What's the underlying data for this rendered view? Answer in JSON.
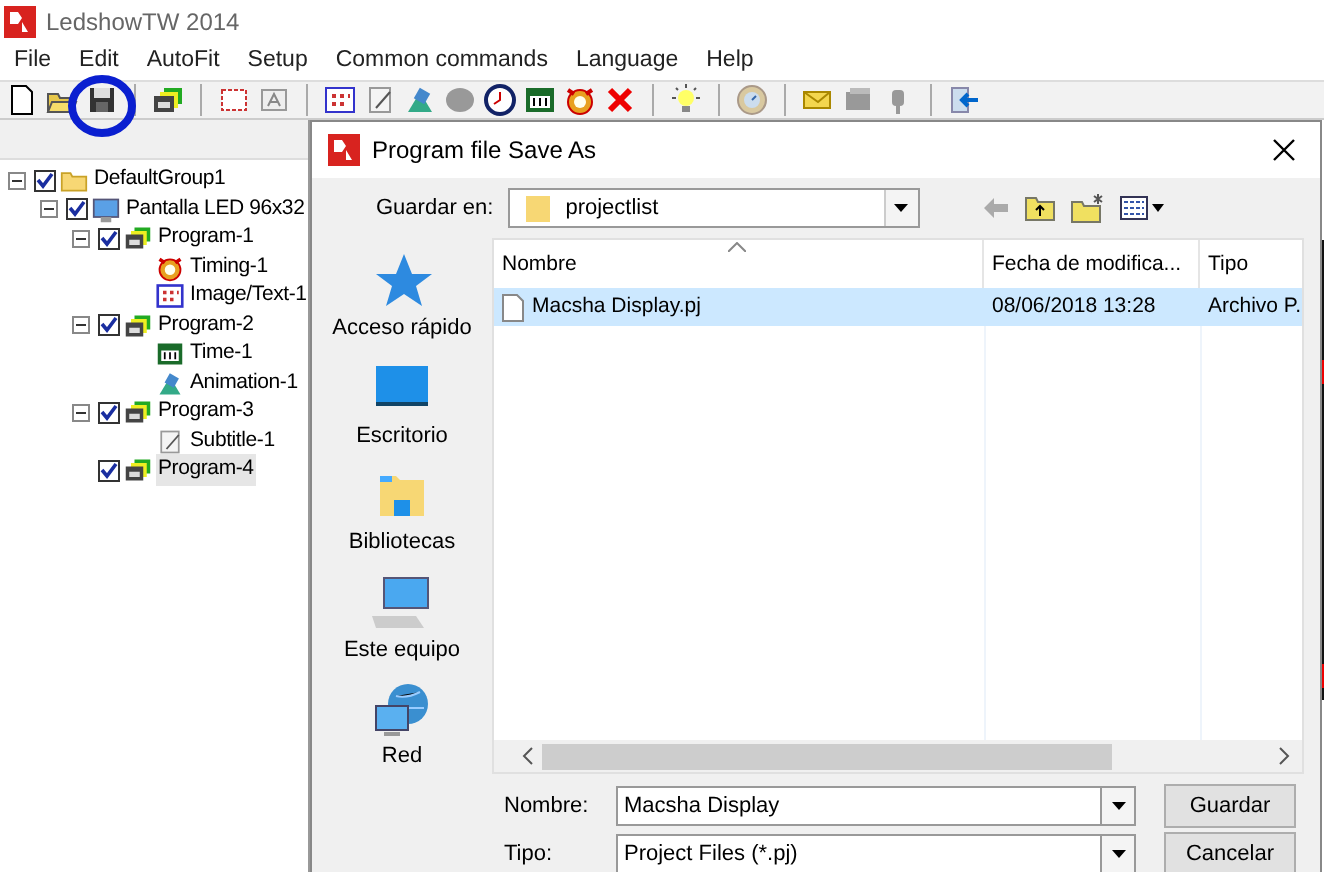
{
  "window": {
    "title": "LedshowTW 2014"
  },
  "menu": [
    "File",
    "Edit",
    "AutoFit",
    "Setup",
    "Common commands",
    "Language",
    "Help"
  ],
  "tree": [
    {
      "label": "DefaultGroup1",
      "kind": "group",
      "checked": true,
      "expanded": true,
      "selected": false,
      "children": [
        {
          "label": "Pantalla LED 96x32",
          "kind": "screen",
          "checked": true,
          "expanded": true,
          "selected": false,
          "children": [
            {
              "label": "Program-1",
              "kind": "program",
              "checked": true,
              "expanded": true,
              "selected": false,
              "children": [
                {
                  "label": "Timing-1",
                  "kind": "timing",
                  "selected": false
                },
                {
                  "label": "Image/Text-1",
                  "kind": "image-text",
                  "selected": false
                }
              ]
            },
            {
              "label": "Program-2",
              "kind": "program",
              "checked": true,
              "expanded": true,
              "selected": false,
              "children": [
                {
                  "label": "Time-1",
                  "kind": "time",
                  "selected": false
                },
                {
                  "label": "Animation-1",
                  "kind": "animation",
                  "selected": false
                }
              ]
            },
            {
              "label": "Program-3",
              "kind": "program",
              "checked": true,
              "expanded": true,
              "selected": false,
              "children": [
                {
                  "label": "Subtitle-1",
                  "kind": "subtitle",
                  "selected": false
                }
              ]
            },
            {
              "label": "Program-4",
              "kind": "program",
              "checked": true,
              "selected": true
            }
          ]
        }
      ]
    }
  ],
  "dialog": {
    "title": "Program file Save As",
    "save_in_label": "Guardar en:",
    "save_in_value": "projectlist",
    "places": [
      {
        "label": "Acceso rápido",
        "kind": "quick-access"
      },
      {
        "label": "Escritorio",
        "kind": "desktop"
      },
      {
        "label": "Bibliotecas",
        "kind": "libraries"
      },
      {
        "label": "Este equipo",
        "kind": "computer"
      },
      {
        "label": "Red",
        "kind": "network"
      }
    ],
    "columns": [
      "Nombre",
      "Fecha de modifica...",
      "Tipo"
    ],
    "files": [
      {
        "name": "Macsha Display.pj",
        "date": "08/06/2018 13:28",
        "type": "Archivo P.",
        "selected": true
      }
    ],
    "filename_label": "Nombre:",
    "filename_value": "Macsha Display",
    "filetype_label": "Tipo:",
    "filetype_value": "Project Files (*.pj)",
    "buttons": [
      "Guardar",
      "Cancelar"
    ]
  }
}
